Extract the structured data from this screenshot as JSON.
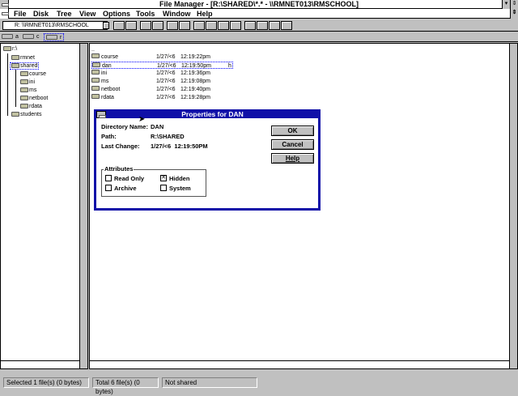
{
  "window": {
    "title": "File Manager - [R:\\SHARED\\*.* - \\\\RMNET013\\RMSCHOOL]"
  },
  "menu": [
    "File",
    "Disk",
    "Tree",
    "View",
    "Options",
    "Tools",
    "Window",
    "Help"
  ],
  "toolbar": {
    "drive": "R: \\\\RMNET013\\RMSCHOOL"
  },
  "drives": [
    "a",
    "c",
    "r"
  ],
  "tree": {
    "root": "r:\\",
    "items": [
      {
        "label": "rmnet",
        "level": 1
      },
      {
        "label": "shared",
        "level": 1
      },
      {
        "label": "course",
        "level": 2
      },
      {
        "label": "ini",
        "level": 2
      },
      {
        "label": "ms",
        "level": 2
      },
      {
        "label": "netboot",
        "level": 2
      },
      {
        "label": "rdata",
        "level": 2
      },
      {
        "label": "students",
        "level": 1
      }
    ]
  },
  "files": {
    "up": "..",
    "rows": [
      {
        "name": "course",
        "date": "1/27/<6",
        "time": "12:19:22pm",
        "attr": ""
      },
      {
        "name": "dan",
        "date": "1/27/<6",
        "time": "12:19:50pm",
        "attr": "h"
      },
      {
        "name": "ini",
        "date": "1/27/<6",
        "time": "12:19:36pm",
        "attr": ""
      },
      {
        "name": "ms",
        "date": "1/27/<6",
        "time": "12:19:08pm",
        "attr": ""
      },
      {
        "name": "netboot",
        "date": "1/27/<6",
        "time": "12:19:40pm",
        "attr": ""
      },
      {
        "name": "rdata",
        "date": "1/27/<6",
        "time": "12:19:28pm",
        "attr": ""
      }
    ]
  },
  "dialog": {
    "title": "Properties for DAN",
    "dir_label": "Directory Name:",
    "dir_value": "DAN",
    "path_label": "Path:",
    "path_value": "R:\\SHARED",
    "change_label": "Last Change:",
    "change_value": "1/27/<6  12:19:50PM",
    "ok": "OK",
    "cancel": "Cancel",
    "help": "Help",
    "attributes": "Attributes",
    "read_only": "Read Only",
    "archive": "Archive",
    "hidden": "Hidden",
    "system": "System",
    "hidden_checked": true,
    "hidden_mark": "✕"
  },
  "status": {
    "selected": "Selected 1 file(s) (0 bytes)",
    "total": "Total 6 file(s) (0 bytes)",
    "shared": "Not shared"
  }
}
